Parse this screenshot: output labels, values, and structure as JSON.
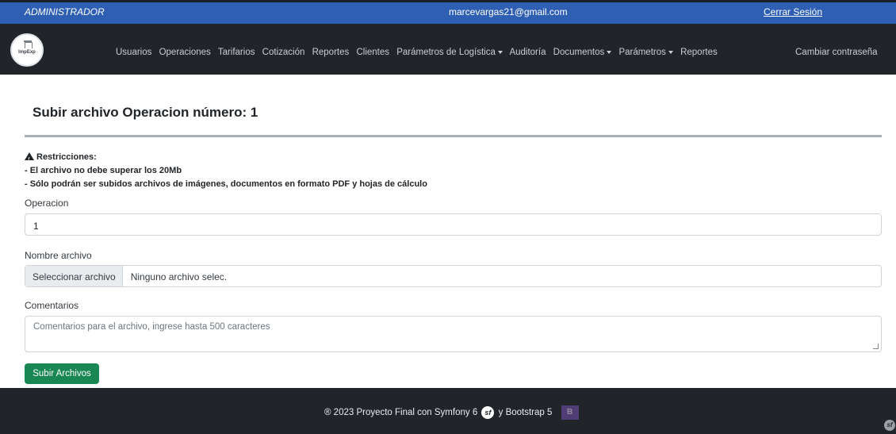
{
  "topbar": {
    "role": "ADMINISTRADOR",
    "email": "marcevargas21@gmail.com",
    "logout": "Cerrar Sesión"
  },
  "nav": {
    "logo_text": "ImpExp",
    "items": [
      "Usuarios",
      "Operaciones",
      "Tarifarios",
      "Cotización",
      "Reportes",
      "Clientes",
      "Parámetros de Logística",
      "Auditoría",
      "Documentos",
      "Parámetros",
      "Reportes"
    ],
    "change_password": "Cambiar contraseña"
  },
  "page": {
    "title": "Subir archivo Operacion número: 1",
    "restrictions_title": "Restricciones:",
    "restriction_1": "- El archivo no debe superar los 20Mb",
    "restriction_2": "- Sólo podrán ser subidos archivos de imágenes, documentos en formato PDF y hojas de cálculo"
  },
  "form": {
    "operacion_label": "Operacion",
    "operacion_value": "1",
    "nombre_label": "Nombre archivo",
    "file_button": "Seleccionar archivo",
    "file_status": "Ninguno archivo selec.",
    "comentarios_label": "Comentarios",
    "comentarios_placeholder": "Comentarios para el archivo, ingrese hasta 500 caracteres",
    "submit": "Subir Archivos"
  },
  "footer": {
    "text_1": "® 2023 Proyecto Final con Symfony 6",
    "text_2": "y Bootstrap 5",
    "symfony_glyph": "sf",
    "bootstrap_glyph": "B"
  },
  "colors": {
    "topbar": "#2f5fb3",
    "navbar": "#212529",
    "submit": "#198754",
    "footer": "#212529"
  }
}
